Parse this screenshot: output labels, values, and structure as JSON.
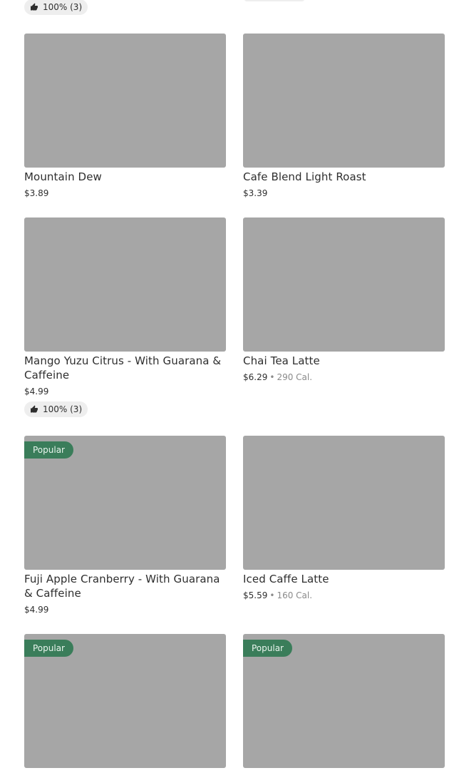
{
  "items": [
    {
      "name": "Mountain Dew",
      "price": "$3.89"
    },
    {
      "name": "Cafe Blend Light Roast",
      "price": "$3.39"
    },
    {
      "name": "Mango Yuzu Citrus - With Guarana & Caffeine",
      "price": "$4.99",
      "rating": "100% (3)"
    },
    {
      "name": "Chai Tea Latte",
      "price": "$6.29",
      "calories": "290 Cal."
    },
    {
      "name": "Fuji Apple Cranberry - With Guarana & Caffeine",
      "price": "$4.99",
      "badge": "Popular"
    },
    {
      "name": "Iced Caffe Latte",
      "price": "$5.59",
      "calories": "160 Cal."
    },
    {
      "name": "",
      "price": "",
      "badge": "Popular"
    },
    {
      "name": "",
      "price": "",
      "badge": "Popular"
    }
  ],
  "top_rating": "100% (3)",
  "colors": {
    "popular_badge": "#3a7d5a",
    "thumb_placeholder": "#a6a6a6",
    "rating_pill": "#eeeeee"
  },
  "icons": {
    "rating": "thumbs-up-icon"
  }
}
